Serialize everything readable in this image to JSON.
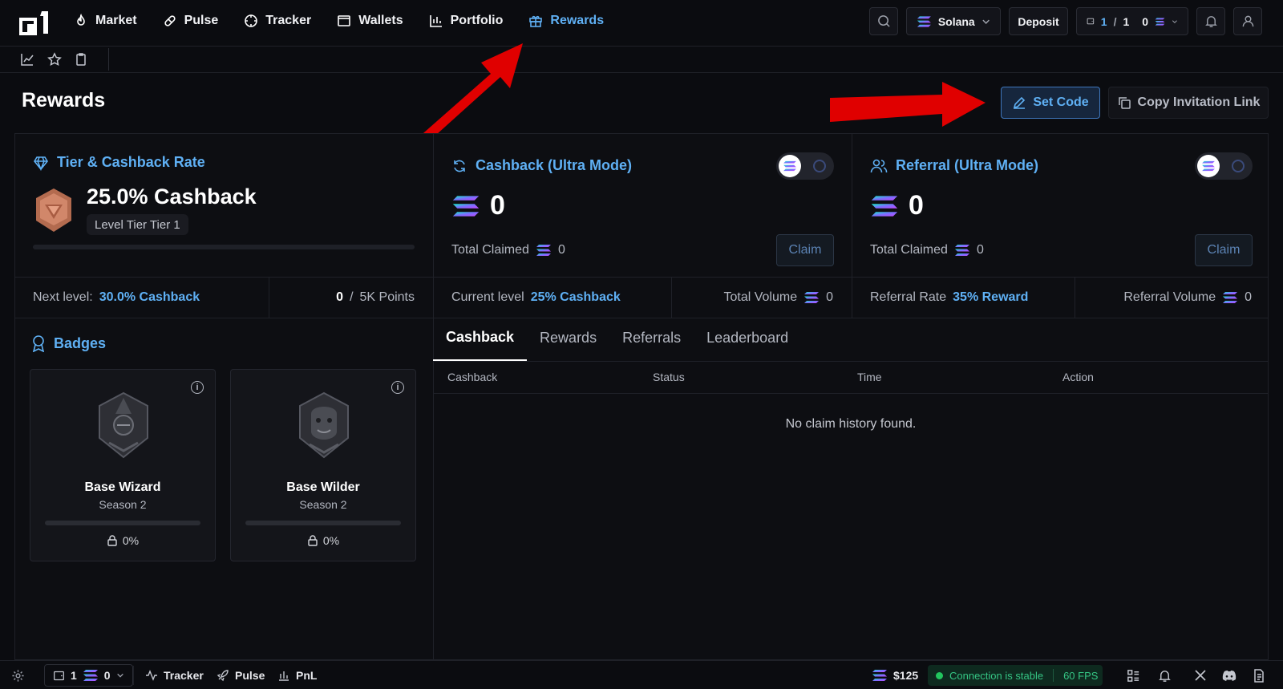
{
  "nav": {
    "items": [
      {
        "label": "Market",
        "icon": "flame-icon"
      },
      {
        "label": "Pulse",
        "icon": "pill-icon"
      },
      {
        "label": "Tracker",
        "icon": "crosshair-icon"
      },
      {
        "label": "Wallets",
        "icon": "wallet-icon"
      },
      {
        "label": "Portfolio",
        "icon": "chart-icon"
      },
      {
        "label": "Rewards",
        "icon": "gift-icon"
      }
    ],
    "active": "Rewards"
  },
  "topbar": {
    "chain": "Solana",
    "deposit": "Deposit",
    "wallet_count": "1",
    "wallet_sep": "/",
    "wallet_total": "1",
    "wallet_balance": "0"
  },
  "page": {
    "title": "Rewards",
    "set_code": "Set Code",
    "copy_link": "Copy Invitation Link"
  },
  "tier": {
    "title": "Tier & Cashback Rate",
    "cashback": "25.0% Cashback",
    "level": "Level Tier Tier 1",
    "next_level_label": "Next level:",
    "next_level_value": "30.0% Cashback",
    "points_current": "0",
    "points_sep": "/",
    "points_goal": "5K Points"
  },
  "cashback": {
    "title": "Cashback (Ultra Mode)",
    "amount": "0",
    "total_claimed_label": "Total Claimed",
    "total_claimed": "0",
    "claim": "Claim",
    "current_level_label": "Current level",
    "current_level_value": "25% Cashback",
    "total_volume_label": "Total Volume",
    "total_volume": "0"
  },
  "referral": {
    "title": "Referral (Ultra Mode)",
    "amount": "0",
    "total_claimed_label": "Total Claimed",
    "total_claimed": "0",
    "claim": "Claim",
    "rate_label": "Referral Rate",
    "rate_value": "35% Reward",
    "volume_label": "Referral Volume",
    "volume": "0"
  },
  "badges": {
    "title": "Badges",
    "items": [
      {
        "name": "Base Wizard",
        "season": "Season 2",
        "progress": "0%"
      },
      {
        "name": "Base Wilder",
        "season": "Season 2",
        "progress": "0%"
      }
    ]
  },
  "history": {
    "tabs": [
      "Cashback",
      "Rewards",
      "Referrals",
      "Leaderboard"
    ],
    "active_tab": "Cashback",
    "columns": [
      "Cashback",
      "Status",
      "Time",
      "Action"
    ],
    "empty": "No claim history found."
  },
  "bottombar": {
    "wallet_count": "1",
    "wallet_balance": "0",
    "tracker": "Tracker",
    "pulse": "Pulse",
    "pnl": "PnL",
    "sol_price": "$125",
    "connection": "Connection is stable",
    "fps": "60 FPS"
  },
  "colors": {
    "accent": "#5fb0f4",
    "background": "#0b0c10",
    "success": "#35c584",
    "annotation_arrow": "#e00000"
  }
}
